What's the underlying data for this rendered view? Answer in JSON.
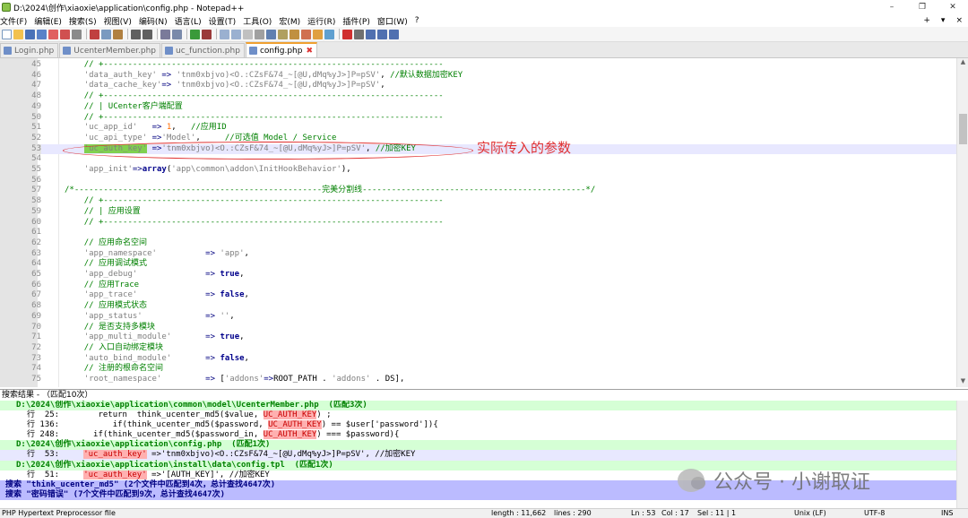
{
  "window": {
    "title": "D:\\2024\\创作\\xiaoxie\\application\\config.php - Notepad++",
    "minimize": "–",
    "maximize": "❐",
    "close": "✕"
  },
  "menu": {
    "items": [
      "文件(F)",
      "编辑(E)",
      "搜索(S)",
      "视图(V)",
      "编码(N)",
      "语言(L)",
      "设置(T)",
      "工具(O)",
      "宏(M)",
      "运行(R)",
      "插件(P)",
      "窗口(W)",
      "?"
    ],
    "right": [
      "+",
      "▾",
      "×"
    ]
  },
  "tabs": [
    {
      "label": "Login.php",
      "active": false
    },
    {
      "label": "UcenterMember.php",
      "active": false
    },
    {
      "label": "uc_function.php",
      "active": false
    },
    {
      "label": "config.php",
      "active": true
    }
  ],
  "editor": {
    "lines": [
      {
        "n": "45",
        "html": "    <span class=\"c-cm\">// +----------------------------------------------------------------------</span>"
      },
      {
        "n": "46",
        "html": "    <span class=\"c-str\">'data_auth_key'</span> <span class=\"c-op\">=&gt;</span> <span class=\"c-str\">'tnm0xbjvo)&lt;O.:CZsF&amp;74_~[@U,dMq%yJ&gt;]P=pSV'</span>, <span class=\"c-cm\">//默认数据加密KEY</span>"
      },
      {
        "n": "47",
        "html": "    <span class=\"c-str\">'data_cache_key'</span><span class=\"c-op\">=&gt;</span> <span class=\"c-str\">'tnm0xbjvo)&lt;O.:CZsF&amp;74_~[@U,dMq%yJ&gt;]P=pSV'</span>,"
      },
      {
        "n": "48",
        "html": "    <span class=\"c-cm\">// +----------------------------------------------------------------------</span>"
      },
      {
        "n": "49",
        "html": "    <span class=\"c-cm\">// | UCenter客户端配置</span>"
      },
      {
        "n": "50",
        "html": "    <span class=\"c-cm\">// +----------------------------------------------------------------------</span>"
      },
      {
        "n": "51",
        "html": "    <span class=\"c-str\">'uc_app_id'</span>   <span class=\"c-op\">=&gt;</span> <span class=\"c-num\">1</span>,   <span class=\"c-cm\">//应用ID</span>"
      },
      {
        "n": "52",
        "html": "    <span class=\"c-str\">'uc_api_type'</span> <span class=\"c-op\">=&gt;</span><span class=\"c-str\">'Model'</span>,     <span class=\"c-cm\">//可选值 Model / Service</span>"
      },
      {
        "n": "53",
        "html": "    <span class=\"c-hl\"><span class=\"c-str\">'uc_auth_key'</span></span> <span class=\"c-op\">=&gt;</span><span class=\"c-str\">'tnm0xbjvo)&lt;O.:CZsF&amp;74_~[@U,dMq%yJ&gt;]P=pSV'</span>, <span class=\"c-cm\">//加密KEY</span>",
        "current": true
      },
      {
        "n": "54",
        "html": ""
      },
      {
        "n": "55",
        "html": "    <span class=\"c-str\">'app_init'</span><span class=\"c-op\">=&gt;</span><span class=\"c-kw\">array</span>(<span class=\"c-str\">'app\\common\\addon\\InitHookBehavior'</span>),"
      },
      {
        "n": "56",
        "html": ""
      },
      {
        "n": "57",
        "html": "<span class=\"c-cm\">/*---------------------------------------------------完美分割线----------------------------------------------*/</span>"
      },
      {
        "n": "58",
        "html": "    <span class=\"c-cm\">// +----------------------------------------------------------------------</span>"
      },
      {
        "n": "59",
        "html": "    <span class=\"c-cm\">// | 应用设置</span>"
      },
      {
        "n": "60",
        "html": "    <span class=\"c-cm\">// +----------------------------------------------------------------------</span>"
      },
      {
        "n": "61",
        "html": ""
      },
      {
        "n": "62",
        "html": "    <span class=\"c-cm\">// 应用命名空间</span>"
      },
      {
        "n": "63",
        "html": "    <span class=\"c-str\">'app_namespace'</span>          <span class=\"c-op\">=&gt;</span> <span class=\"c-str\">'app'</span>,"
      },
      {
        "n": "64",
        "html": "    <span class=\"c-cm\">// 应用调试模式</span>"
      },
      {
        "n": "65",
        "html": "    <span class=\"c-str\">'app_debug'</span>              <span class=\"c-op\">=&gt;</span> <span class=\"c-kw\">true</span>,"
      },
      {
        "n": "66",
        "html": "    <span class=\"c-cm\">// 应用Trace</span>"
      },
      {
        "n": "67",
        "html": "    <span class=\"c-str\">'app_trace'</span>              <span class=\"c-op\">=&gt;</span> <span class=\"c-kw\">false</span>,"
      },
      {
        "n": "68",
        "html": "    <span class=\"c-cm\">// 应用模式状态</span>"
      },
      {
        "n": "69",
        "html": "    <span class=\"c-str\">'app_status'</span>             <span class=\"c-op\">=&gt;</span> <span class=\"c-str\">''</span>,"
      },
      {
        "n": "70",
        "html": "    <span class=\"c-cm\">// 是否支持多模块</span>"
      },
      {
        "n": "71",
        "html": "    <span class=\"c-str\">'app_multi_module'</span>       <span class=\"c-op\">=&gt;</span> <span class=\"c-kw\">true</span>,"
      },
      {
        "n": "72",
        "html": "    <span class=\"c-cm\">// 入口自动绑定模块</span>"
      },
      {
        "n": "73",
        "html": "    <span class=\"c-str\">'auto_bind_module'</span>       <span class=\"c-op\">=&gt;</span> <span class=\"c-kw\">false</span>,"
      },
      {
        "n": "74",
        "html": "    <span class=\"c-cm\">// 注册的根命名空间</span>"
      },
      {
        "n": "75",
        "html": "    <span class=\"c-str\">'root_namespace'</span>         <span class=\"c-op\">=&gt;</span> [<span class=\"c-str\">'addons'</span><span class=\"c-op\">=&gt;</span>ROOT_PATH . <span class=\"c-str\">'addons'</span> . DS],"
      }
    ]
  },
  "annotation": {
    "label": "实际传入的参数"
  },
  "results": {
    "header": "搜索结果 - （匹配10次）",
    "lines": [
      {
        "type": "file",
        "html": "D:\\2024\\创作\\xiaoxie\\application\\common\\model\\UcenterMember.php  (匹配3次)"
      },
      {
        "type": "hit",
        "html": "行  25:        return  think_ucenter_md5($value, <span class=\"mk\">UC_AUTH_KEY</span>) ;"
      },
      {
        "type": "hit",
        "html": "行 136:           if(think_ucenter_md5($password, <span class=\"mk\">UC_AUTH_KEY</span>) == $user['password']){"
      },
      {
        "type": "hit",
        "html": "行 248:       if(think_ucenter_md5($password_in, <span class=\"mk\">UC_AUTH_KEY</span>) === $password){"
      },
      {
        "type": "file",
        "html": "D:\\2024\\创作\\xiaoxie\\application\\config.php  (匹配1次)"
      },
      {
        "type": "hit-sel",
        "html": "行  53:     <span class=\"mk\">'uc_auth_key'</span> =&gt;'tnm0xbjvo)&lt;O.:CZsF&amp;74_~[@U,dMq%yJ&gt;]P=pSV', //加密KEY"
      },
      {
        "type": "file",
        "html": "D:\\2024\\创作\\xiaoxie\\application\\install\\data\\config.tpl  (匹配1次)"
      },
      {
        "type": "hit",
        "html": "行  51:     <span class=\"mk\">'uc_auth_key'</span> =&gt;'[AUTH_KEY]', //加密KEY"
      },
      {
        "type": "search",
        "html": "搜索 \"think_ucenter_md5\" (2个文件中匹配到4次，总计查找4647次)"
      },
      {
        "type": "search",
        "html": "搜索 \"密码错误\" (7个文件中匹配到9次，总计查找4647次)"
      }
    ]
  },
  "watermark": {
    "text": "公众号 · 小谢取证"
  },
  "status": {
    "filetype": "PHP Hypertext Preprocessor file",
    "length": "length : 11,662",
    "lines": "lines : 290",
    "ln": "Ln : 53",
    "col": "Col : 17",
    "sel": "Sel : 11 | 1",
    "eol": "Unix (LF)",
    "encoding": "UTF-8",
    "mode": "INS"
  },
  "colors": {
    "accent": "#f0a030",
    "annotation": "#e03030",
    "current_line": "#e8e8ff"
  }
}
